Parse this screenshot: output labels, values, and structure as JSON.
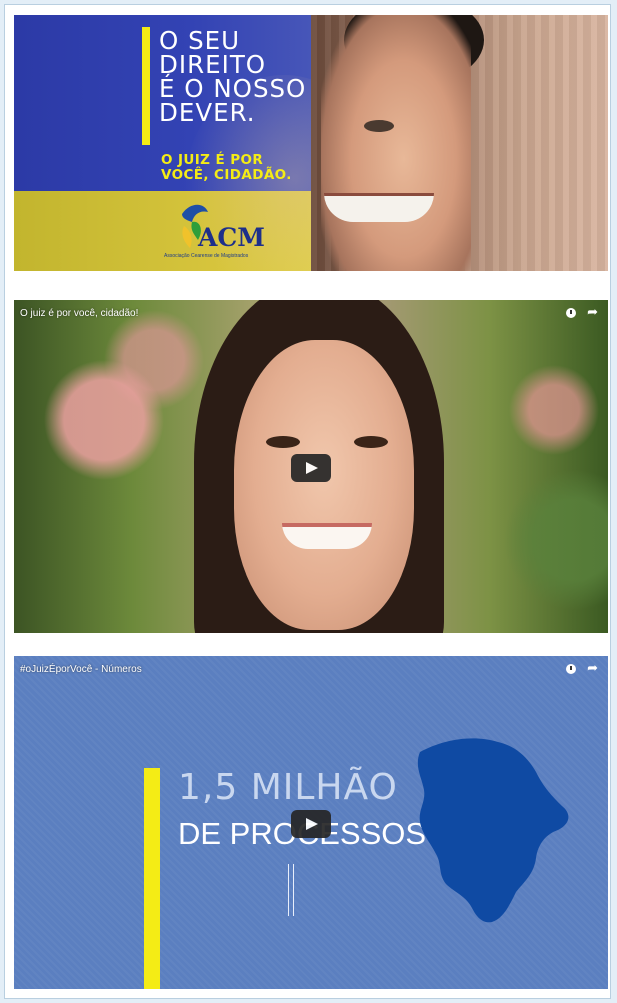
{
  "banner": {
    "headline_lines": [
      "O SEU",
      "DIREITO",
      "É O NOSSO",
      "DEVER."
    ],
    "slogan_lines": [
      "O JUIZ É POR",
      "VOCÊ, CIDADÃO."
    ],
    "logo_text": "ACM",
    "logo_subtitle": "Associação Cearense de Magistrados",
    "colors": {
      "blue": "#2c3aa6",
      "yellow": "#f4ec15"
    }
  },
  "videos": [
    {
      "title": "O juiz é por você, cidadão!",
      "icons": [
        "clock-icon",
        "share-icon",
        "play-icon"
      ]
    },
    {
      "title": "#oJuizÉporVocê - Números",
      "overlay_line1": "1,5 MILHÃO",
      "overlay_line2": "DE PROCESSOS",
      "icons": [
        "clock-icon",
        "share-icon",
        "play-icon"
      ],
      "background": "#5b7fc0"
    }
  ]
}
